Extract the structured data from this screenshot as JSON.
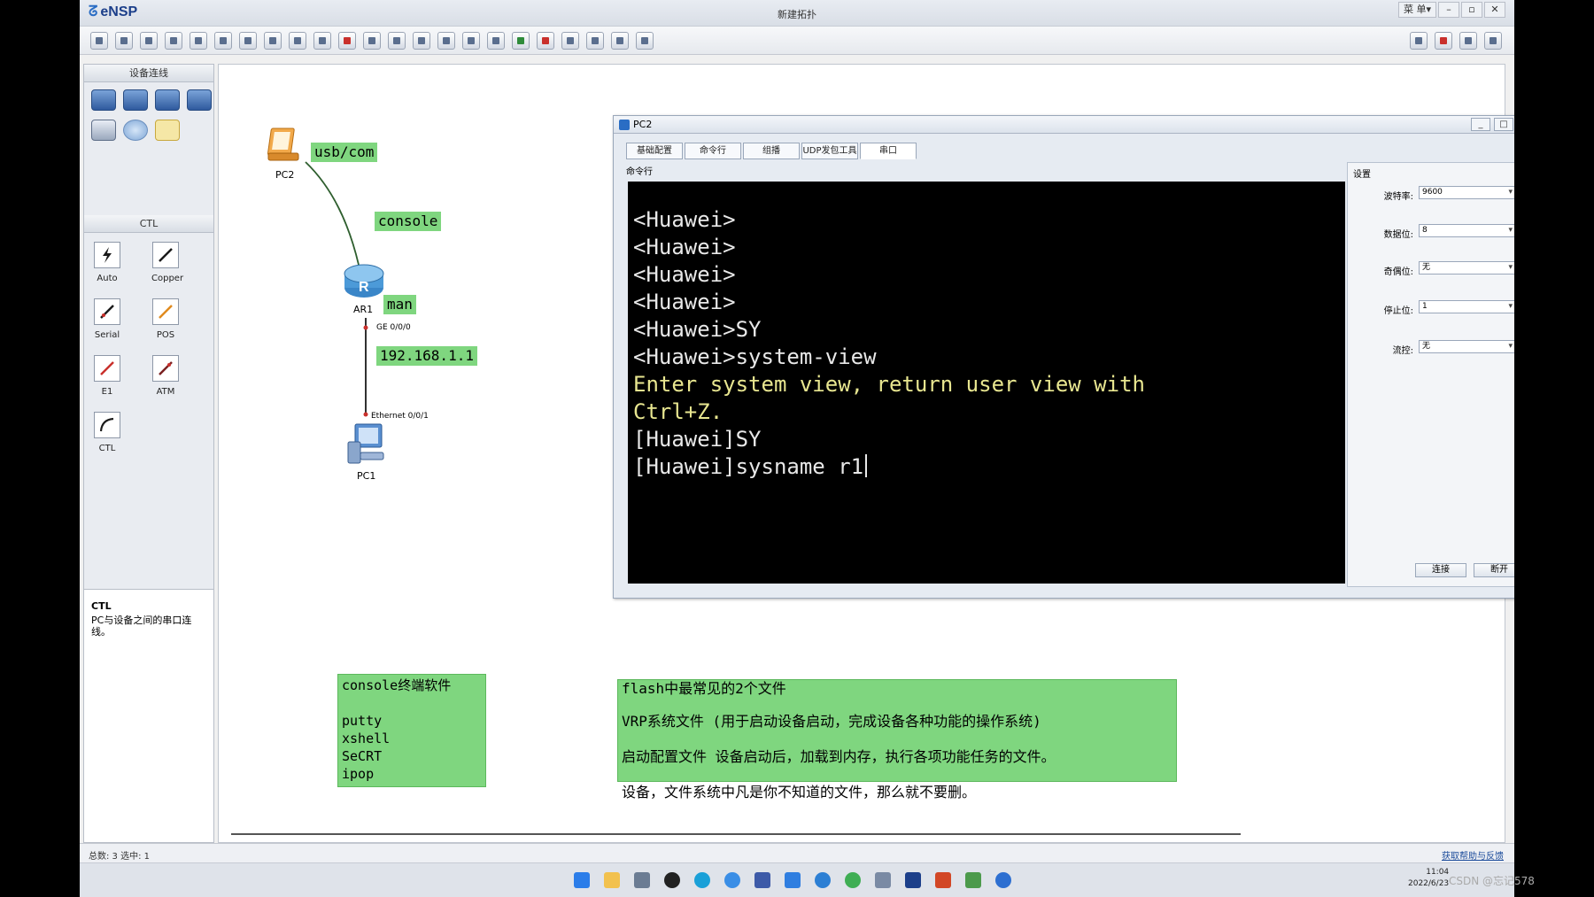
{
  "app": {
    "name": "eNSP",
    "window_title": "新建拓扑",
    "menu_label": "菜 单▾",
    "controls": {
      "minimize": "–",
      "restore": "▫",
      "close": "✕"
    }
  },
  "toolbar": {
    "icons": [
      "new-topology-icon",
      "open-icon",
      "save-icon",
      "save-as-icon",
      "print-icon",
      "undo-icon",
      "redo-icon",
      "select-icon",
      "hand-icon",
      "delete-icon",
      "text-icon",
      "rect-icon",
      "zoom-in-icon",
      "zoom-out-icon",
      "start-icon",
      "stop-icon",
      "capture-icon",
      "settings-icon",
      "help-icon"
    ]
  },
  "left_panel": {
    "devices_header": "设备连线",
    "ctl_header": "CTL",
    "cables": [
      {
        "label": "Auto",
        "icon": "lightning-icon",
        "color": "#1a1a1a"
      },
      {
        "label": "Copper",
        "icon": "copper-cable-icon",
        "color": "#1a1a1a"
      },
      {
        "label": "Serial",
        "icon": "serial-cable-icon",
        "color": "#1a1a1a"
      },
      {
        "label": "POS",
        "icon": "pos-cable-icon",
        "color": "#e08a1e"
      },
      {
        "label": "E1",
        "icon": "e1-cable-icon",
        "color": "#c9302c"
      },
      {
        "label": "ATM",
        "icon": "atm-cable-icon",
        "color": "#7a2020"
      },
      {
        "label": "CTL",
        "icon": "ctl-cable-icon",
        "color": "#1a1a1a"
      }
    ],
    "description_title": "CTL",
    "description_text": "PC与设备之间的串口连线。"
  },
  "topology": {
    "pc2_label": "PC2",
    "ar1_label": "AR1",
    "pc1_label": "PC1",
    "port_ge": "GE 0/0/0",
    "port_eth": "Ethernet 0/0/1",
    "tag_usb": "usb/com",
    "tag_console": "console",
    "tag_man": "man",
    "tag_ip": "192.168.1.1",
    "note_console": "console终端软件\n\nputty\nxshell\nSeCRT\nipop",
    "note_flash_title": "flash中最常见的2个文件",
    "note_flash_lines": [
      "VRP系统文件  (用于启动设备启动，完成设备各种功能的操作系统)",
      "启动配置文件  设备启动后，加载到内存，执行各项功能任务的文件。",
      "设备，文件系统中凡是你不知道的文件，那么就不要删。"
    ]
  },
  "pc2_dialog": {
    "title": "PC2",
    "tabs": [
      "基础配置",
      "命令行",
      "组播",
      "UDP发包工具",
      "串口"
    ],
    "active_tab": "串口",
    "cmd_header": "命令行",
    "terminal_lines": [
      "<Huawei>",
      "<Huawei>",
      "<Huawei>",
      "<Huawei>",
      "<Huawei>SY",
      "<Huawei>system-view",
      "Enter system view, return user view with",
      "Ctrl+Z.",
      "[Huawei]SY",
      "[Huawei]sysname r1"
    ],
    "settings": {
      "title": "设置",
      "baud_label": "波特率:",
      "baud_value": "9600",
      "databits_label": "数据位:",
      "databits_value": "8",
      "parity_label": "奇偶位:",
      "parity_value": "无",
      "stopbits_label": "停止位:",
      "stopbits_value": "1",
      "flow_label": "流控:",
      "flow_value": "无",
      "connect_button": "连接",
      "disconnect_button": "断开"
    }
  },
  "status_bar": {
    "text": "总数: 3 选中: 1",
    "feedback": "获取帮助与反馈"
  },
  "taskbar": {
    "time": "11:04",
    "date": "2022/6/23",
    "watermark": "CSDN @忘记578"
  }
}
